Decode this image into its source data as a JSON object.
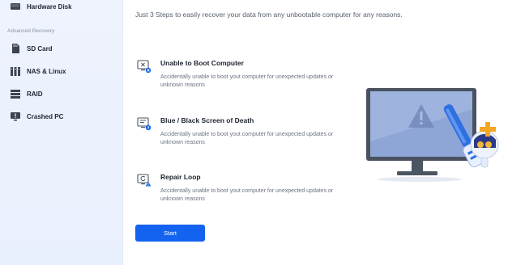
{
  "sidebar": {
    "items_top": [
      {
        "label": "Hardware Disk",
        "icon": "hard-disk-icon"
      }
    ],
    "section_label": "Advanced Recovery",
    "items": [
      {
        "label": "SD Card",
        "icon": "sd-card-icon"
      },
      {
        "label": "NAS & Linux",
        "icon": "nas-icon"
      },
      {
        "label": "RAID",
        "icon": "raid-icon"
      },
      {
        "label": "Crashed PC",
        "icon": "crashed-pc-icon"
      }
    ]
  },
  "main": {
    "subtitle": "Just 3 Steps to easily recover your data from any unbootable computer for any reasons.",
    "steps": [
      {
        "title": "Unable to Boot Computer",
        "desc": "Accidentally unable to boot yout computer for unexpected updates or unknown reasons",
        "icon": "boot-error-icon"
      },
      {
        "title": "Blue / Black Screen of Death",
        "desc": "Accidentally unable to boot yout computer for unexpected updates or unknown reasons",
        "icon": "screen-death-icon"
      },
      {
        "title": "Repair Loop",
        "desc": "Accidentally unable to boot yout computer for unexpected updates or unknown reasons",
        "icon": "repair-loop-icon"
      }
    ],
    "start_label": "Start"
  },
  "colors": {
    "accent": "#1463f0",
    "sidebar_bg": "#eef3fd",
    "warning": "#f5a623"
  }
}
